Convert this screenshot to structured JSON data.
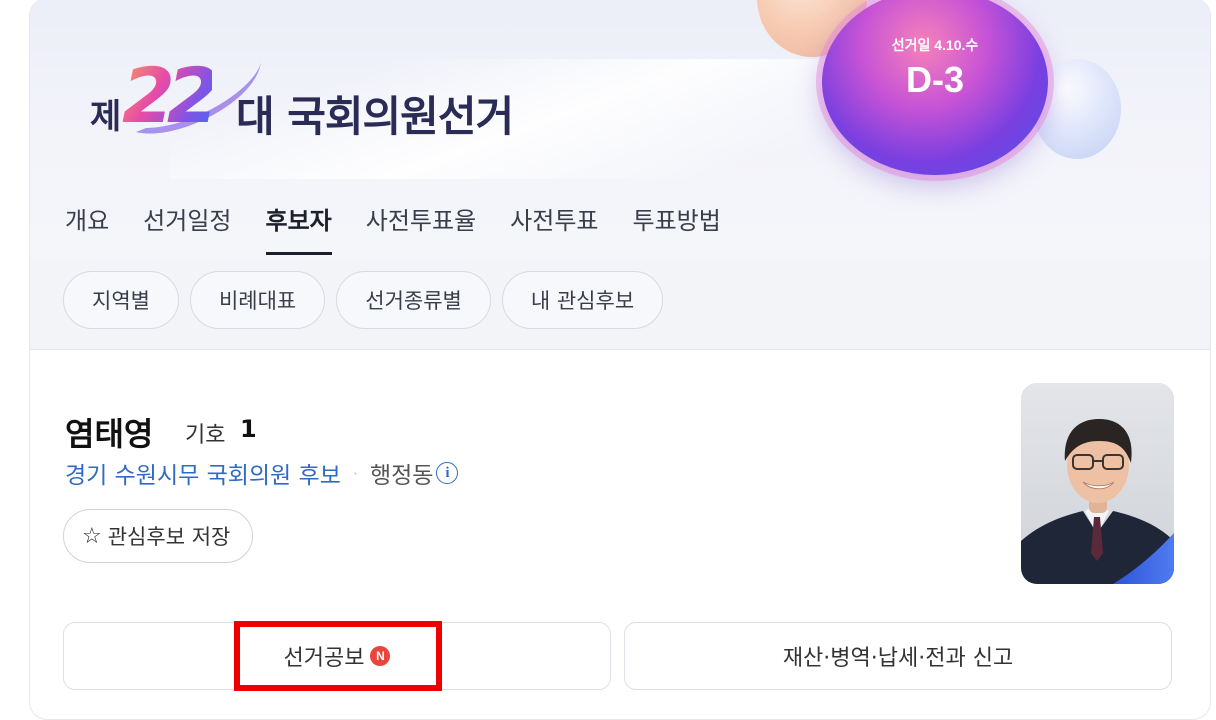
{
  "header": {
    "logo": {
      "prefix": "제",
      "number": "22",
      "suffix": "대 국회의원선거"
    },
    "dday": {
      "label": "선거일 4.10.수",
      "value": "D-3"
    }
  },
  "tabs": [
    {
      "label": "개요",
      "active": false
    },
    {
      "label": "선거일정",
      "active": false
    },
    {
      "label": "후보자",
      "active": true
    },
    {
      "label": "사전투표율",
      "active": false
    },
    {
      "label": "사전투표",
      "active": false
    },
    {
      "label": "투표방법",
      "active": false
    }
  ],
  "subtabs": [
    "지역별",
    "비례대표",
    "선거종류별",
    "내 관심후보"
  ],
  "candidate": {
    "name": "염태영",
    "number_label": "기호",
    "number": "1",
    "district": "경기 수원시무 국회의원 후보",
    "admin_area": "행정동",
    "info_icon": "i",
    "favorite_icon": "☆",
    "favorite_label": "관심후보 저장"
  },
  "actions": {
    "pledge_label": "선거공보",
    "new_badge": "N",
    "report_label": "재산·병역·납세·전과 신고"
  },
  "colors": {
    "link": "#2f6bc5",
    "new_badge": "#e8453c",
    "highlight": "#ee0000"
  }
}
